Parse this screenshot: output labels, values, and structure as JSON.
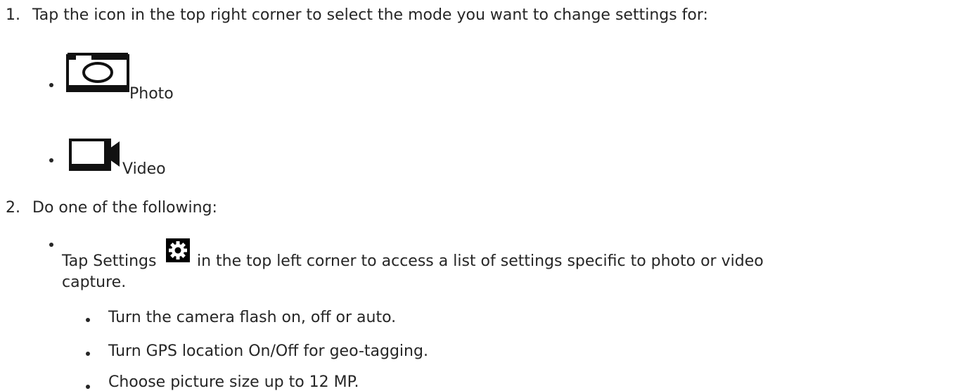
{
  "steps": [
    {
      "number": "1.",
      "text": "Tap the icon in the top right corner to select the mode you want to change settings for:",
      "modes": [
        {
          "icon": "camera-icon",
          "label": "Photo"
        },
        {
          "icon": "video-camera-icon",
          "label": "Video"
        }
      ]
    },
    {
      "number": "2.",
      "text": "Do one of the following:",
      "option": {
        "prefix": "Tap Settings",
        "icon": "settings-gear-icon",
        "suffix_line1": "in the top left corner to access a list of settings specific to photo or video",
        "suffix_line2": "capture.",
        "sub_items": [
          "Turn the camera flash on, off or auto.",
          "Turn GPS location On/Off for geo-tagging.",
          "Choose picture size up to 12 MP."
        ]
      }
    }
  ]
}
